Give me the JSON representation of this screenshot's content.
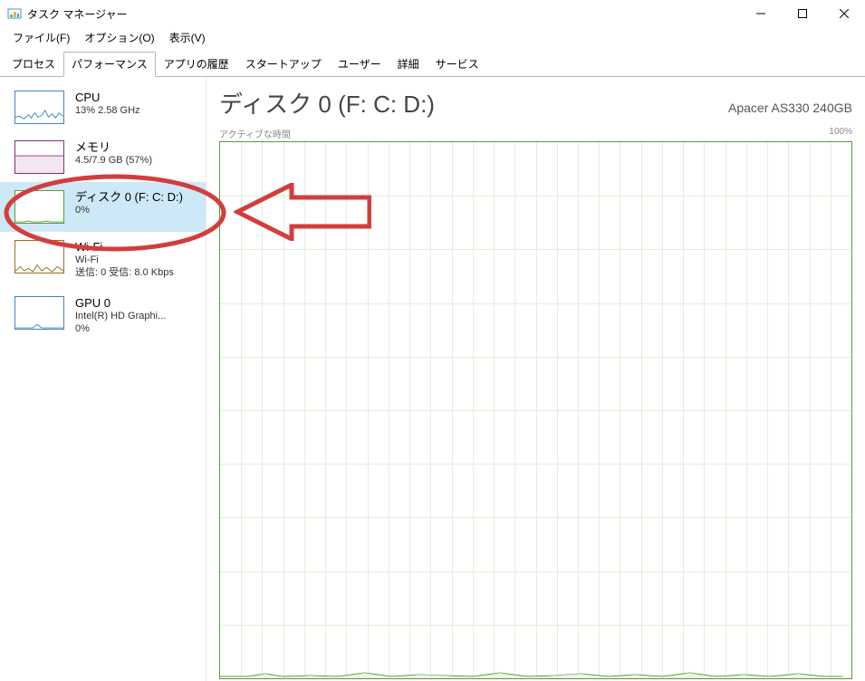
{
  "window": {
    "title": "タスク マネージャー"
  },
  "menu": {
    "file": "ファイル(F)",
    "options": "オプション(O)",
    "view": "表示(V)"
  },
  "tabs": {
    "processes": "プロセス",
    "performance": "パフォーマンス",
    "app_history": "アプリの履歴",
    "startup": "スタートアップ",
    "users": "ユーザー",
    "details": "詳細",
    "services": "サービス"
  },
  "sidebar": {
    "cpu": {
      "title": "CPU",
      "sub": "13%  2.58 GHz"
    },
    "memory": {
      "title": "メモリ",
      "sub": "4.5/7.9 GB (57%)"
    },
    "disk0": {
      "title": "ディスク 0 (F: C: D:)",
      "sub": "0%"
    },
    "wifi": {
      "title": "Wi-Fi",
      "sub1": "Wi-Fi",
      "sub2": "送信: 0 受信: 8.0 Kbps"
    },
    "gpu0": {
      "title": "GPU 0",
      "sub1": "Intel(R) HD Graphi...",
      "sub2": "0%"
    }
  },
  "detail": {
    "title": "ディスク 0 (F: C: D:)",
    "model": "Apacer AS330 240GB",
    "graph_left_label": "アクティブな時間",
    "graph_right_label": "100%"
  }
}
